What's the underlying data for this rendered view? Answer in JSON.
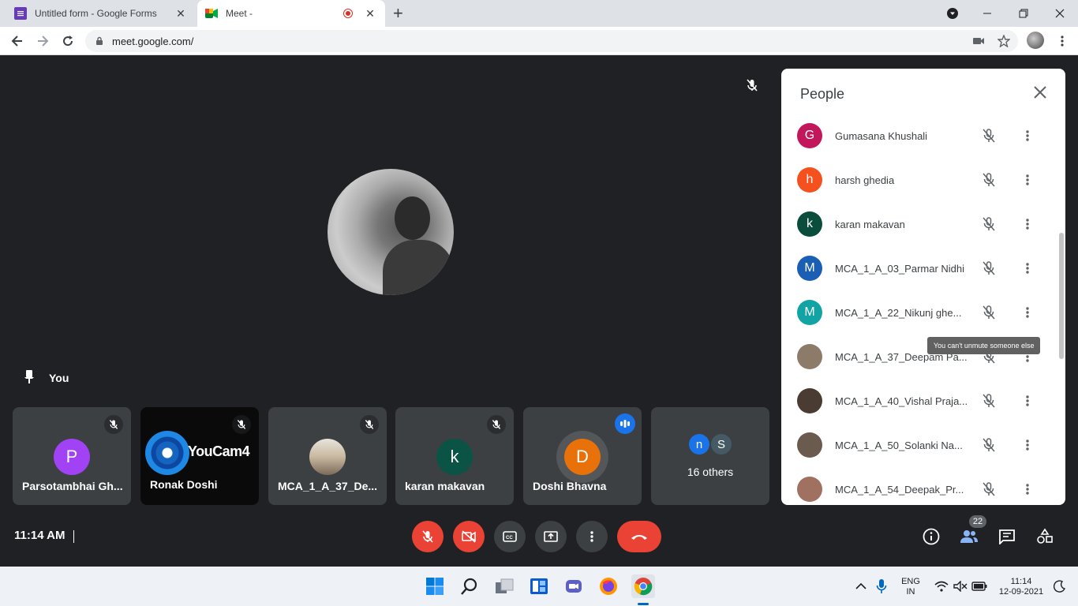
{
  "browser": {
    "tabs": [
      {
        "title": "Untitled form - Google Forms",
        "close": "✕"
      },
      {
        "title": "Meet -",
        "close": "✕"
      }
    ],
    "new_tab": "+",
    "url": "meet.google.com/"
  },
  "meet": {
    "pinned_label": "You",
    "tiles": [
      {
        "name": "Parsotambhai Gh...",
        "initial": "P",
        "color": "#a142f4"
      },
      {
        "name": "Ronak Doshi",
        "youcam_text": "YouCam4"
      },
      {
        "name": "MCA_1_A_37_De..."
      },
      {
        "name": "karan makavan",
        "initial": "k",
        "color": "#0b5345"
      },
      {
        "name": "Doshi Bhavna",
        "initial": "D",
        "color": "#e8710a"
      },
      {
        "name": "16 others",
        "initials": [
          "n",
          "S"
        ]
      }
    ]
  },
  "people_panel": {
    "title": "People",
    "tooltip": "You can't unmute someone else",
    "participants": [
      {
        "name": "Gumasana Khushali",
        "initial": "G",
        "color": "#c2185b"
      },
      {
        "name": "harsh ghedia",
        "initial": "h",
        "color": "#f4511e"
      },
      {
        "name": "karan makavan",
        "initial": "k",
        "color": "#0b4d3c"
      },
      {
        "name": "MCA_1_A_03_Parmar Nidhi",
        "initial": "M",
        "color": "#1a5fb4"
      },
      {
        "name": "MCA_1_A_22_Nikunj ghe...",
        "initial": "M",
        "color": "#12a4a4"
      },
      {
        "name": "MCA_1_A_37_Deepam Pa...",
        "initial": "",
        "color": "#8d7b6a"
      },
      {
        "name": "MCA_1_A_40_Vishal Praja...",
        "initial": "",
        "color": "#4a3b33"
      },
      {
        "name": "MCA_1_A_50_Solanki Na...",
        "initial": "",
        "color": "#6b5a4e"
      },
      {
        "name": "MCA_1_A_54_Deepak_Pr...",
        "initial": "",
        "color": "#a07060"
      }
    ]
  },
  "controls": {
    "time": "11:14 AM",
    "people_count": "22"
  },
  "taskbar": {
    "lang_line1": "ENG",
    "lang_line2": "IN",
    "clock_time": "11:14",
    "clock_date": "12-09-2021"
  }
}
